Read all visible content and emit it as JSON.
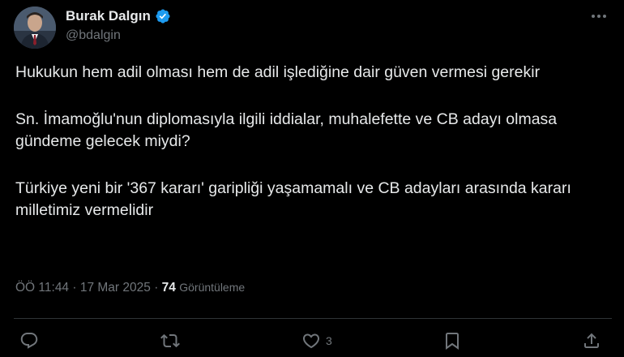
{
  "author": {
    "display_name": "Burak Dalgın",
    "handle": "@bdalgin",
    "verified": true
  },
  "tweet": {
    "paragraphs": [
      "Hukukun hem adil olması hem de adil işlediğine dair güven vermesi gerekir",
      "Sn. İmamoğlu'nun diplomasıyla ilgili iddialar, muhalefette ve CB adayı olmasa gündeme gelecek miydi?",
      "Türkiye yeni bir '367 kararı' garipliği yaşamamalı ve CB adayları arasında kararı milletimiz vermelidir"
    ],
    "timestamp": "ÖÖ 11:44 · 17 Mar 2025",
    "separator": "·",
    "views_count": "74",
    "views_label": "Görüntüleme"
  },
  "actions": {
    "reply_icon": "reply-icon",
    "retweet_icon": "retweet-icon",
    "like_icon": "heart-icon",
    "like_count": "3",
    "bookmark_icon": "bookmark-icon",
    "share_icon": "share-icon"
  },
  "colors": {
    "background": "#000000",
    "text": "#e7e9ea",
    "secondary": "#71767b",
    "verified": "#1d9bf0",
    "divider": "#2f3336"
  }
}
